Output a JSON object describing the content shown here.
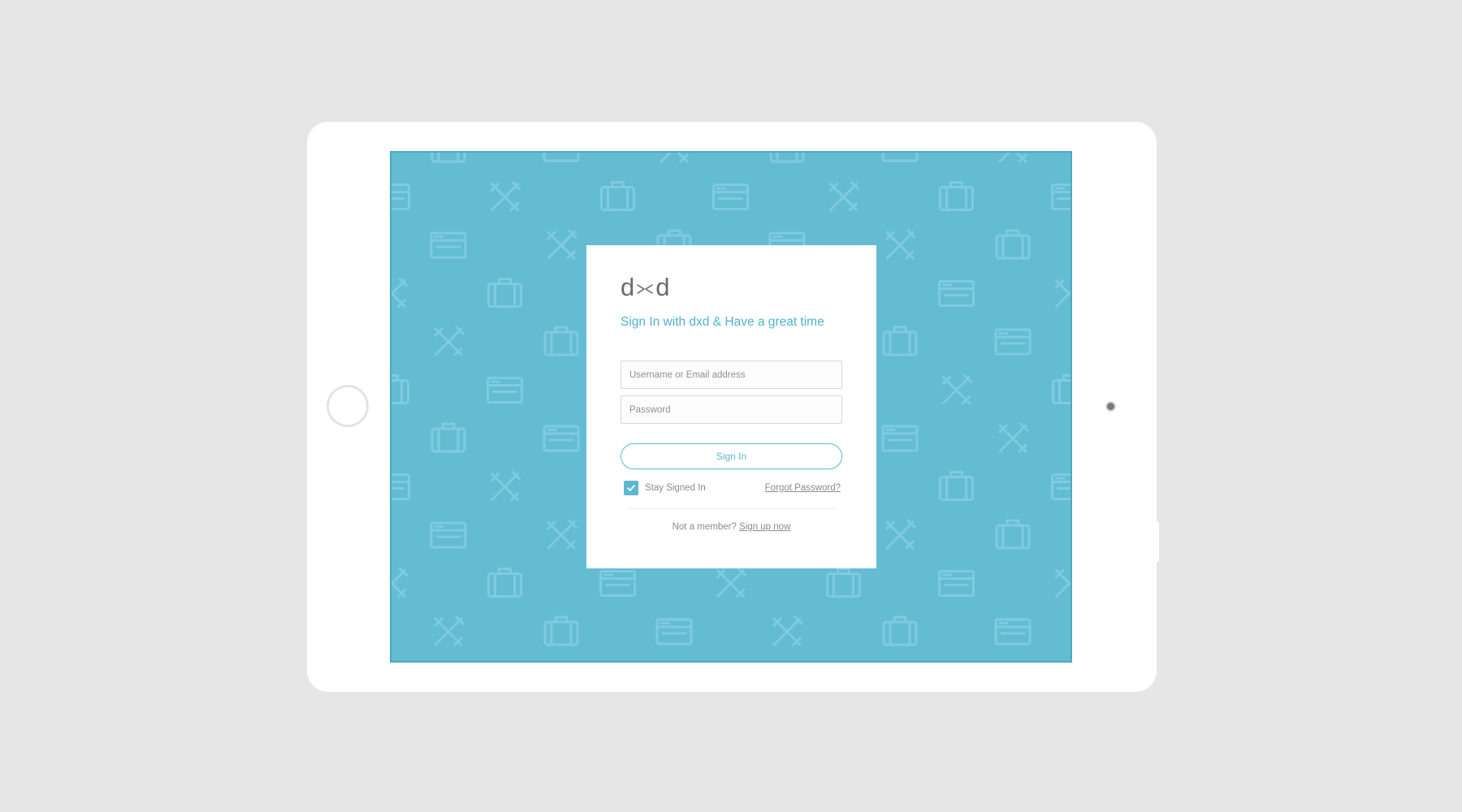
{
  "logo": {
    "left_letter": "d",
    "right_letter": "d"
  },
  "headline": "Sign In with dxd & Have a great time",
  "form": {
    "username_placeholder": "Username or Email address",
    "password_placeholder": "Password",
    "signin_label": "Sign In",
    "stay_signed_in_label": "Stay Signed In",
    "stay_signed_in_checked": true,
    "forgot_password_label": "Forgot Password?",
    "not_member_text": "Not a member?",
    "signup_label": "Sign up now"
  },
  "colors": {
    "screen_background": "#64bcd3",
    "accent": "#4eb2ce",
    "pattern_stroke": "#7ecbe0"
  },
  "background_pattern_icons": [
    "tools-icon",
    "briefcase-icon",
    "browser-window-icon"
  ]
}
